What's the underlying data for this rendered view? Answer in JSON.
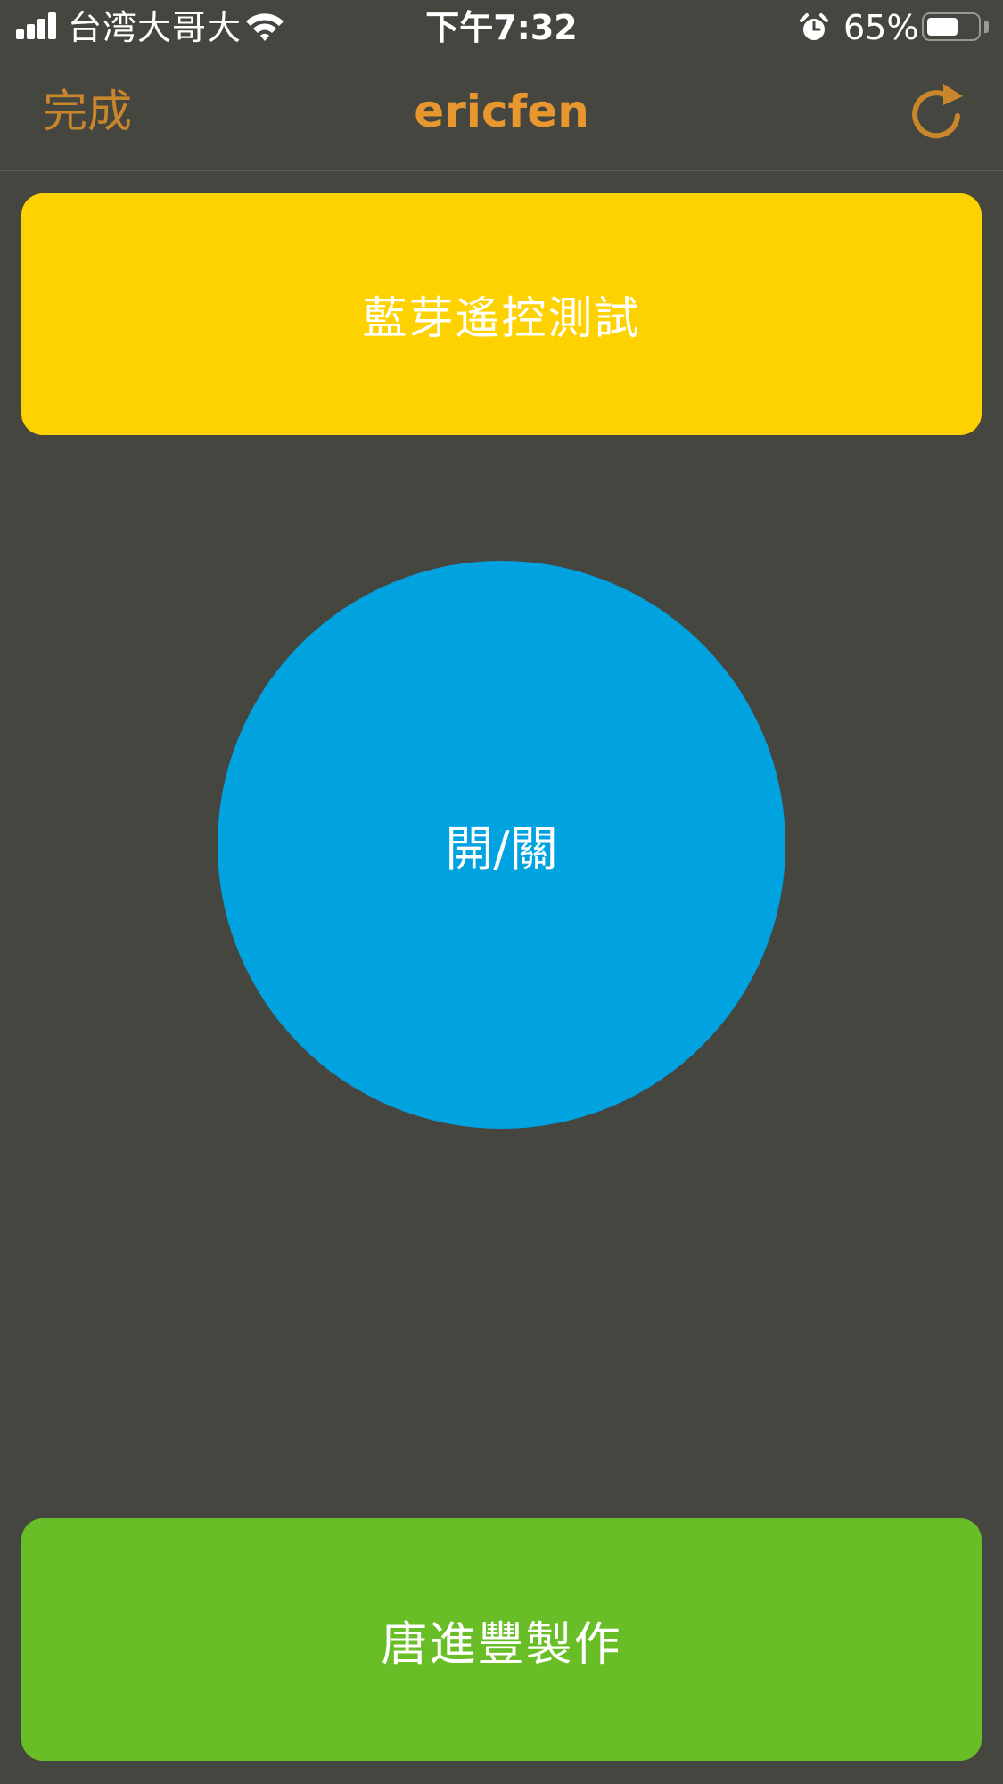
{
  "status_bar": {
    "carrier": "台湾大哥大",
    "time": "下午7:32",
    "battery_percent": "65%",
    "battery_level": 0.65,
    "icons": [
      "signal-icon",
      "wifi-icon",
      "alarm-icon",
      "battery-icon"
    ]
  },
  "nav": {
    "done_label": "完成",
    "title": "ericfen",
    "refresh_icon": "refresh-icon"
  },
  "header": {
    "label": "藍芽遙控測試"
  },
  "toggle": {
    "label": "開/關"
  },
  "footer": {
    "label": "唐進豐製作"
  },
  "colors": {
    "background": "#464641",
    "accent": "#e8962e",
    "header": "#fdd200",
    "toggle": "#00a2e0",
    "footer": "#69be28"
  }
}
